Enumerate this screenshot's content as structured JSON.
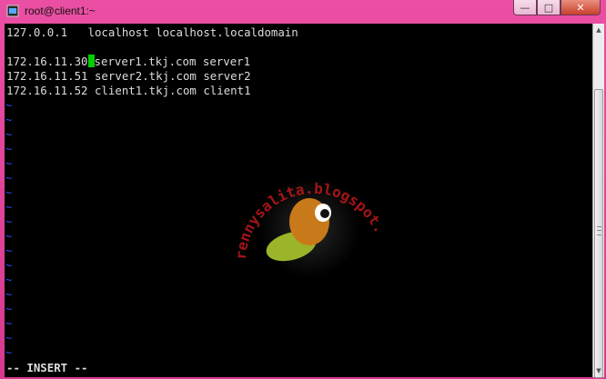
{
  "window": {
    "title": "root@client1:~",
    "buttons": {
      "minimize": "—",
      "maximize": "□",
      "close": "✕"
    }
  },
  "terminal": {
    "lines": [
      "127.0.0.1   localhost localhost.localdomain",
      "",
      "172.16.11.30",
      "172.16.11.51 server2.tkj.com server2",
      "172.16.11.52 client1.tkj.com client1"
    ],
    "line3_after_cursor": "server1.tkj.com server1",
    "tilde": "~",
    "status": "-- INSERT --"
  },
  "watermark": {
    "text": "rennysalita.blogspot.com"
  },
  "colors": {
    "titlebar": "#e04898",
    "background": "#000000",
    "text": "#dcdcdc",
    "cursor": "#00d000",
    "tilde": "#2650ff"
  }
}
